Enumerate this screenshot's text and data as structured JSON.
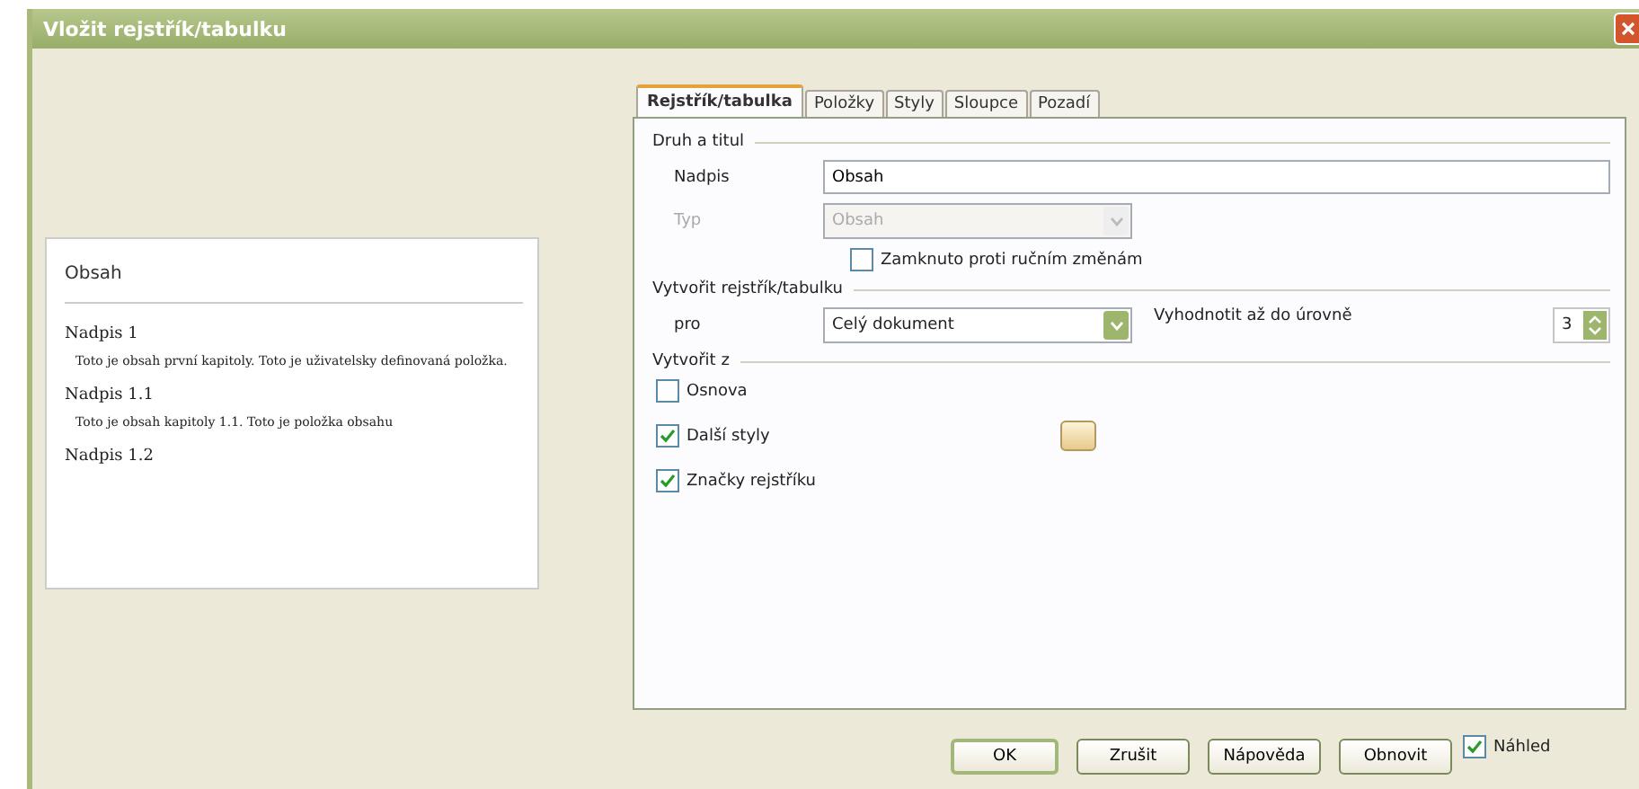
{
  "window": {
    "title": "Vložit rejstřík/tabulku"
  },
  "preview": {
    "title": "Obsah",
    "entries": [
      {
        "kind": "heading",
        "text": "Nadpis 1"
      },
      {
        "kind": "body",
        "text": "Toto je obsah první kapitoly. Toto je uživatelsky definovaná položka."
      },
      {
        "kind": "heading",
        "text": "Nadpis 1.1"
      },
      {
        "kind": "body",
        "text": "Toto je obsah kapitoly 1.1. Toto je položka obsahu"
      },
      {
        "kind": "heading",
        "text": "Nadpis 1.2"
      }
    ]
  },
  "tabs": [
    {
      "label": "Rejstřík/tabulka",
      "selected": true
    },
    {
      "label": "Položky",
      "selected": false
    },
    {
      "label": "Styly",
      "selected": false
    },
    {
      "label": "Sloupce",
      "selected": false
    },
    {
      "label": "Pozadí",
      "selected": false
    }
  ],
  "type_and_title": {
    "heading": "Druh a titul",
    "title_label": "Nadpis",
    "title_value": "Obsah",
    "type_label": "Typ",
    "type_value": "Obsah",
    "type_disabled": true,
    "lock": {
      "label": "Zamknuto proti ručním změnám",
      "checked": false
    }
  },
  "create_index": {
    "heading": "Vytvořit rejstřík/tabulku",
    "for_label": "pro",
    "for_value": "Celý dokument",
    "level_label": "Vyhodnotit až do úrovně",
    "level_value": "3"
  },
  "create_from": {
    "heading": "Vytvořit z",
    "options": [
      {
        "label": "Osnova",
        "checked": false,
        "has_button": false
      },
      {
        "label": "Další styly",
        "checked": true,
        "has_button": true
      },
      {
        "label": "Značky rejstříku",
        "checked": true,
        "has_button": false
      }
    ]
  },
  "buttons": [
    {
      "label": "OK",
      "kind": "default"
    },
    {
      "label": "Zrušit",
      "kind": "normal"
    },
    {
      "label": "Nápověda",
      "kind": "normal"
    },
    {
      "label": "Obnovit",
      "kind": "normal"
    }
  ],
  "preview_toggle": {
    "label": "Náhled",
    "checked": true
  }
}
